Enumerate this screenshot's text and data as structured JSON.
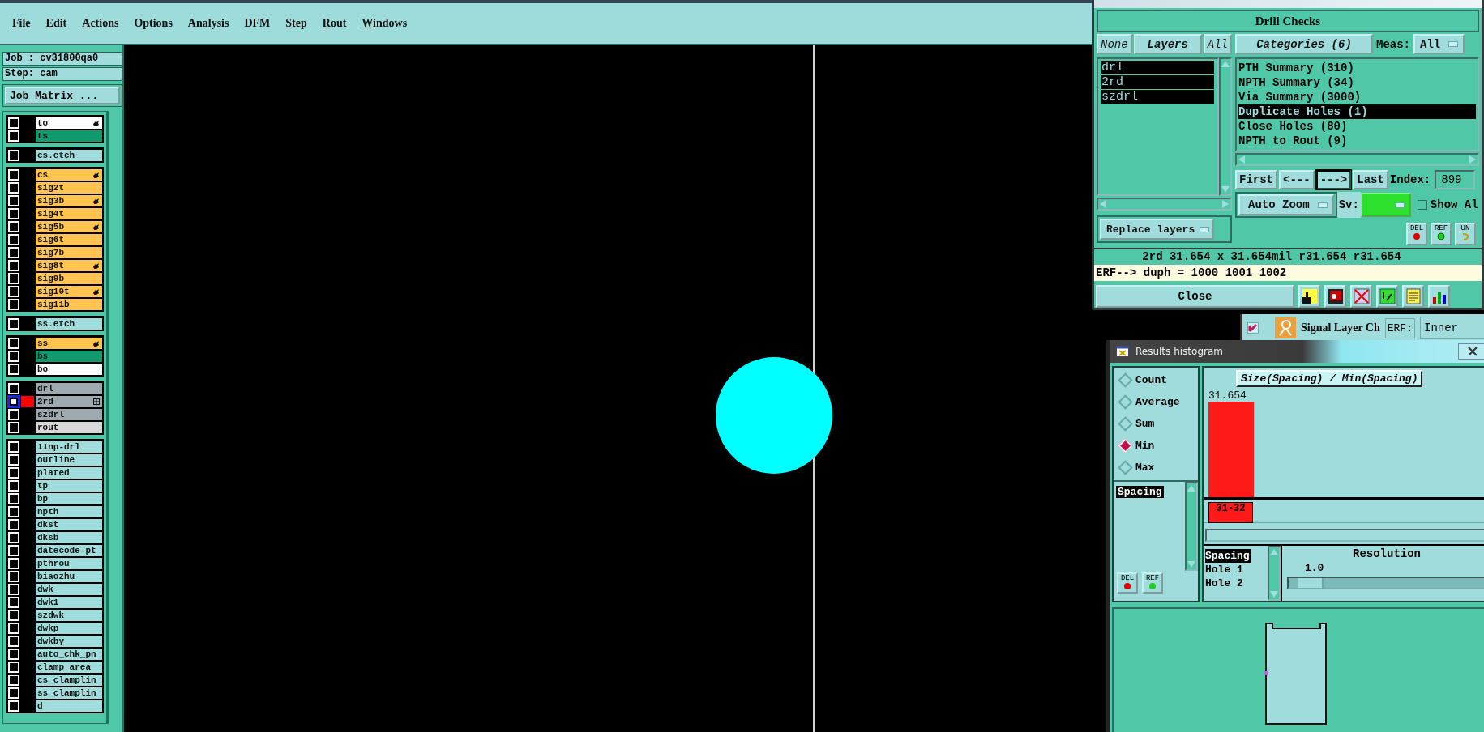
{
  "menu": [
    {
      "label": "File",
      "underlined": true
    },
    {
      "label": "Edit",
      "underlined": true
    },
    {
      "label": "Actions",
      "underlined": true
    },
    {
      "label": "Options",
      "underlined": false
    },
    {
      "label": "Analysis",
      "underlined": false
    },
    {
      "label": "DFM",
      "underlined": false
    },
    {
      "label": "Step",
      "underlined": true
    },
    {
      "label": "Rout",
      "underlined": true
    },
    {
      "label": "Windows",
      "underlined": true
    }
  ],
  "left_panel": {
    "job": "Job : cv31800qa0",
    "step": "Step: cam",
    "job_matrix_button": "Job Matrix ...",
    "layer_groups": [
      {
        "layers": [
          {
            "name": "to",
            "color": "#ffffff",
            "kind": "hand",
            "selected": false
          },
          {
            "name": "ts",
            "color": "#129a6e",
            "selected": false
          }
        ]
      },
      {
        "layers": [
          {
            "name": "cs.etch",
            "color": "#a0dcdc",
            "selected": false
          }
        ]
      },
      {
        "layers": [
          {
            "name": "cs",
            "color": "#ffc451",
            "kind": "hand",
            "selected": false
          },
          {
            "name": "sig2t",
            "color": "#ffc451",
            "selected": false
          },
          {
            "name": "sig3b",
            "color": "#ffc451",
            "kind": "hand",
            "selected": false
          },
          {
            "name": "sig4t",
            "color": "#ffc451",
            "selected": false
          },
          {
            "name": "sig5b",
            "color": "#ffc451",
            "kind": "hand",
            "selected": false
          },
          {
            "name": "sig6t",
            "color": "#ffc451",
            "selected": false
          },
          {
            "name": "sig7b",
            "color": "#ffc451",
            "selected": false
          },
          {
            "name": "sig8t",
            "color": "#ffc451",
            "kind": "hand",
            "selected": false
          },
          {
            "name": "sig9b",
            "color": "#ffc451",
            "selected": false
          },
          {
            "name": "sig10t",
            "color": "#ffc451",
            "kind": "hand",
            "selected": false
          },
          {
            "name": "sig11b",
            "color": "#ffc451",
            "selected": false
          }
        ]
      },
      {
        "layers": [
          {
            "name": "ss.etch",
            "color": "#a0dcdc",
            "selected": false
          }
        ]
      },
      {
        "layers": [
          {
            "name": "ss",
            "color": "#ffc451",
            "kind": "hand",
            "selected": false
          },
          {
            "name": "bs",
            "color": "#129a6e",
            "selected": false
          },
          {
            "name": "bo",
            "color": "#ffffff",
            "selected": false
          }
        ]
      },
      {
        "layers": [
          {
            "name": "drl",
            "color": "#9eaab0",
            "selected": false
          },
          {
            "name": "2rd",
            "color": "#9eaab0",
            "kind": "grid",
            "selected": true
          },
          {
            "name": "szdrl",
            "color": "#9eaab0",
            "selected": false
          },
          {
            "name": "rout",
            "color": "#d8d8d8",
            "selected": false
          }
        ]
      },
      {
        "layers": [
          {
            "name": "11np-drl",
            "color": "#a0dcdc",
            "selected": false
          },
          {
            "name": "outline",
            "color": "#a0dcdc",
            "selected": false
          },
          {
            "name": "plated",
            "color": "#a0dcdc",
            "selected": false
          },
          {
            "name": "tp",
            "color": "#a0dcdc",
            "selected": false
          },
          {
            "name": "bp",
            "color": "#a0dcdc",
            "selected": false
          },
          {
            "name": "npth",
            "color": "#a0dcdc",
            "selected": false
          },
          {
            "name": "dkst",
            "color": "#a0dcdc",
            "selected": false
          },
          {
            "name": "dksb",
            "color": "#a0dcdc",
            "selected": false
          },
          {
            "name": "datecode-pt",
            "color": "#a0dcdc",
            "selected": false
          },
          {
            "name": "pthrou",
            "color": "#a0dcdc",
            "selected": false
          },
          {
            "name": "biaozhu",
            "color": "#a0dcdc",
            "selected": false
          },
          {
            "name": "dwk",
            "color": "#a0dcdc",
            "selected": false
          },
          {
            "name": "dwk1",
            "color": "#a0dcdc",
            "selected": false
          },
          {
            "name": "szdwk",
            "color": "#a0dcdc",
            "selected": false
          },
          {
            "name": "dwkp",
            "color": "#a0dcdc",
            "selected": false
          },
          {
            "name": "dwkby",
            "color": "#a0dcdc",
            "selected": false
          },
          {
            "name": "auto_chk_pn",
            "color": "#a0dcdc",
            "selected": false
          },
          {
            "name": "clamp_area",
            "color": "#a0dcdc",
            "selected": false
          },
          {
            "name": "cs_clamplin",
            "color": "#a0dcdc",
            "selected": false
          },
          {
            "name": "ss_clamplin",
            "color": "#a0dcdc",
            "selected": false
          },
          {
            "name": "d",
            "color": "#a0dcdc",
            "selected": false
          }
        ]
      }
    ]
  },
  "drill_checks": {
    "title": "Drill Checks",
    "layer_buttons": [
      "None",
      "Layers",
      "All"
    ],
    "layers": [
      {
        "name": "drl",
        "selected": true
      },
      {
        "name": "2rd",
        "selected": true
      },
      {
        "name": "szdrl",
        "selected": true
      }
    ],
    "replace_dropdown": "Replace layers",
    "categories_button": "Categories (6)",
    "meas_label": "Meas:",
    "meas_value": "All",
    "categories": [
      {
        "label": "PTH Summary (310)",
        "selected": false
      },
      {
        "label": "NPTH Summary (34)",
        "selected": false
      },
      {
        "label": "Via Summary (3000)",
        "selected": false
      },
      {
        "label": "Duplicate Holes (1)",
        "selected": true
      },
      {
        "label": "Close Holes (80)",
        "selected": false
      },
      {
        "label": "NPTH to Rout (9)",
        "selected": false
      }
    ],
    "nav_buttons": [
      {
        "label": "First",
        "selected": false
      },
      {
        "label": "<---",
        "selected": false
      },
      {
        "label": "--->",
        "selected": true
      },
      {
        "label": "Last",
        "selected": false
      }
    ],
    "index_label": "Index:",
    "index_value": "899",
    "zoom_dropdown": "Auto Zoom",
    "sv_label": "Sv:",
    "sv": {
      "color": "#2ee02e"
    },
    "show_all": {
      "label": "Show Al",
      "checked": false
    },
    "tool_buttons": [
      "DEL",
      "REF",
      "UN"
    ],
    "info": "2rd 31.654 x 31.654mil  r31.654  r31.654",
    "erf": "ERF--> duph = 1000 1001 1002",
    "close_button": "Close"
  },
  "signal_strip": {
    "checked": true,
    "label": "Signal Layer Ch",
    "erf_label": "ERF:",
    "erf_value": "Inner"
  },
  "histogram": {
    "title": "Results histogram",
    "modes": [
      {
        "label": "Count",
        "selected": false
      },
      {
        "label": "Average",
        "selected": false
      },
      {
        "label": "Sum",
        "selected": false
      },
      {
        "label": "Min",
        "selected": true
      },
      {
        "label": "Max",
        "selected": false
      }
    ],
    "measures": [
      {
        "label": "Spacing",
        "selected": true
      }
    ],
    "tool_buttons": [
      "DEL",
      "REF"
    ],
    "chart": {
      "title": "Size(Spacing) / Min(Spacing)",
      "bars": [
        {
          "value_label": "31.654",
          "category": "31-32",
          "level": 1.0
        }
      ]
    },
    "fields": [
      {
        "label": "Spacing",
        "selected": true
      },
      {
        "label": "Hole 1",
        "selected": false
      },
      {
        "label": "Hole 2",
        "selected": false
      }
    ],
    "resolution": {
      "label": "Resolution",
      "value": "1.0",
      "level": 0.05
    }
  }
}
